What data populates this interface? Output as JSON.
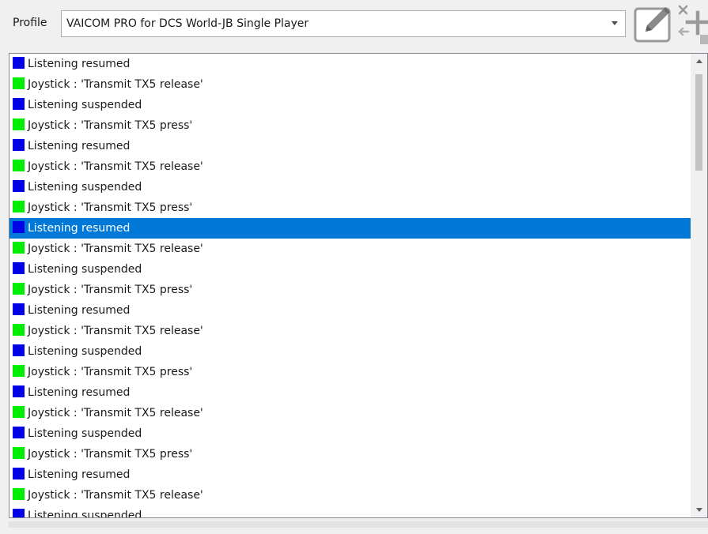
{
  "profile": {
    "label": "Profile",
    "selected_value": "VAICOM PRO for DCS World-JB Single Player"
  },
  "toolbar": {
    "edit_icon": "pencil-edit-icon",
    "addremove_icon": "add-remove-icon"
  },
  "colors": {
    "listening": "#0000e6",
    "joystick": "#00ee00",
    "selection": "#0078d7"
  },
  "log": {
    "selected_index": 8,
    "items": [
      {
        "kind": "listening",
        "text": "Listening resumed"
      },
      {
        "kind": "joystick",
        "text": "Joystick : 'Transmit TX5 release'"
      },
      {
        "kind": "listening",
        "text": "Listening suspended"
      },
      {
        "kind": "joystick",
        "text": "Joystick : 'Transmit TX5 press'"
      },
      {
        "kind": "listening",
        "text": "Listening resumed"
      },
      {
        "kind": "joystick",
        "text": "Joystick : 'Transmit TX5 release'"
      },
      {
        "kind": "listening",
        "text": "Listening suspended"
      },
      {
        "kind": "joystick",
        "text": "Joystick : 'Transmit TX5 press'"
      },
      {
        "kind": "listening",
        "text": "Listening resumed"
      },
      {
        "kind": "joystick",
        "text": "Joystick : 'Transmit TX5 release'"
      },
      {
        "kind": "listening",
        "text": "Listening suspended"
      },
      {
        "kind": "joystick",
        "text": "Joystick : 'Transmit TX5 press'"
      },
      {
        "kind": "listening",
        "text": "Listening resumed"
      },
      {
        "kind": "joystick",
        "text": "Joystick : 'Transmit TX5 release'"
      },
      {
        "kind": "listening",
        "text": "Listening suspended"
      },
      {
        "kind": "joystick",
        "text": "Joystick : 'Transmit TX5 press'"
      },
      {
        "kind": "listening",
        "text": "Listening resumed"
      },
      {
        "kind": "joystick",
        "text": "Joystick : 'Transmit TX5 release'"
      },
      {
        "kind": "listening",
        "text": "Listening suspended"
      },
      {
        "kind": "joystick",
        "text": "Joystick : 'Transmit TX5 press'"
      },
      {
        "kind": "listening",
        "text": "Listening resumed"
      },
      {
        "kind": "joystick",
        "text": "Joystick : 'Transmit TX5 release'"
      },
      {
        "kind": "listening",
        "text": "Listening suspended"
      }
    ]
  },
  "scrollbar": {
    "up_icon": "scroll-up-arrow-icon",
    "down_icon": "scroll-down-arrow-icon"
  }
}
